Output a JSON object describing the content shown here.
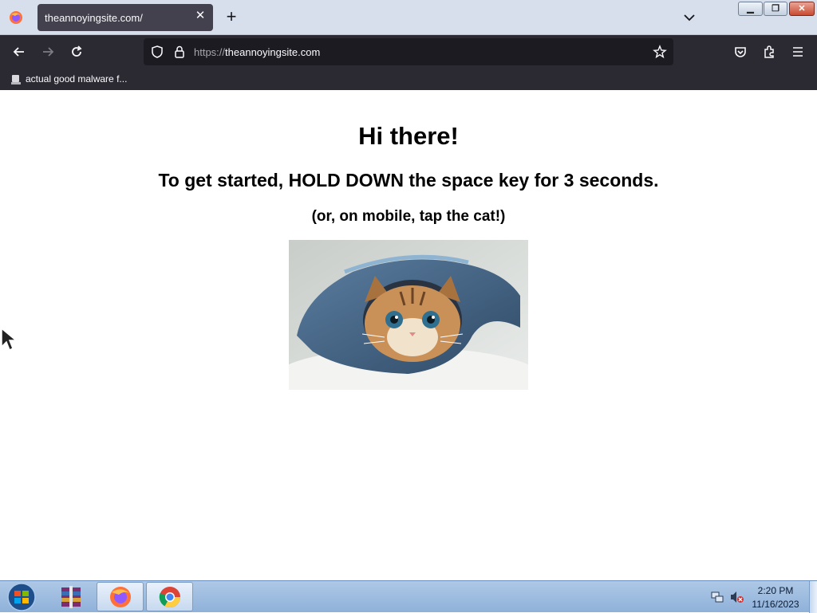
{
  "browser": {
    "tab": {
      "title": "theannoyingsite.com/"
    },
    "url": {
      "protocol": "https://",
      "host": "theannoyingsite.com"
    },
    "bookmarks": [
      {
        "label": "actual good malware f..."
      }
    ]
  },
  "page": {
    "heading": "Hi there!",
    "instructions": "To get started, HOLD DOWN the space key for 3 seconds.",
    "mobile_hint": "(or, on mobile, tap the cat!)",
    "image": {
      "subject": "kitten-in-denim"
    }
  },
  "taskbar": {
    "apps": [
      {
        "icon": "winrar-icon"
      },
      {
        "icon": "firefox-icon",
        "active": true
      },
      {
        "icon": "chrome-icon"
      }
    ],
    "clock": {
      "time": "2:20 PM",
      "date": "11/16/2023"
    }
  },
  "colors": {
    "tab_active": "#42414d",
    "toolbar": "#2b2a33",
    "urlbar": "#1c1b22",
    "taskbar": "#9dbce0"
  }
}
